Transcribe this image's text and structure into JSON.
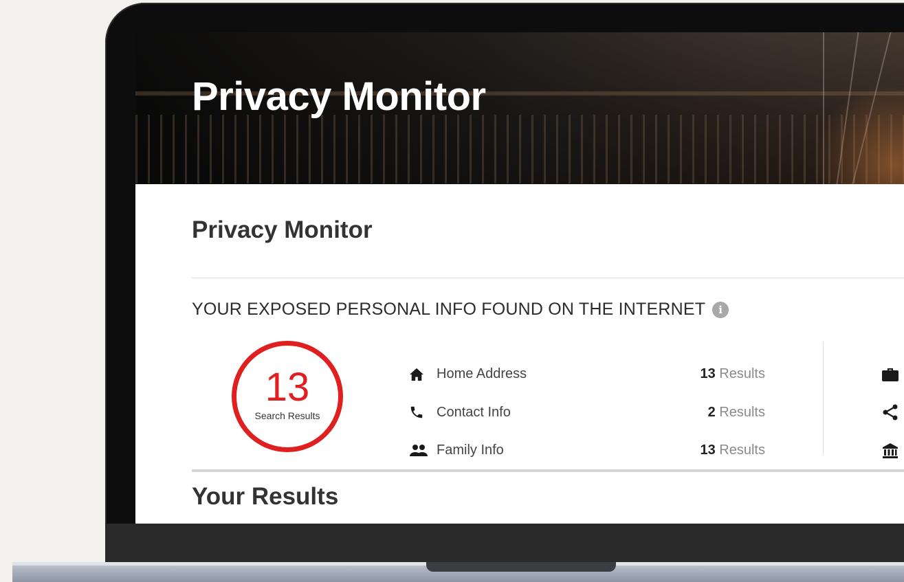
{
  "hero": {
    "title": "Privacy Monitor"
  },
  "page": {
    "title": "Privacy Monitor"
  },
  "exposure": {
    "heading": "YOUR EXPOSED PERSONAL INFO FOUND ON THE INTERNET",
    "info_icon": "info-icon",
    "score": {
      "value": "13",
      "label": "Search Results",
      "color": "#e02020"
    },
    "categories": [
      {
        "icon": "home-icon",
        "label": "Home Address",
        "count": "13",
        "unit": "Results"
      },
      {
        "icon": "phone-icon",
        "label": "Contact Info",
        "count": "2",
        "unit": "Results"
      },
      {
        "icon": "people-icon",
        "label": "Family Info",
        "count": "13",
        "unit": "Results"
      }
    ],
    "right_icons": [
      "briefcase-icon",
      "share-icon",
      "bank-icon"
    ]
  },
  "results": {
    "title": "Your Results"
  }
}
